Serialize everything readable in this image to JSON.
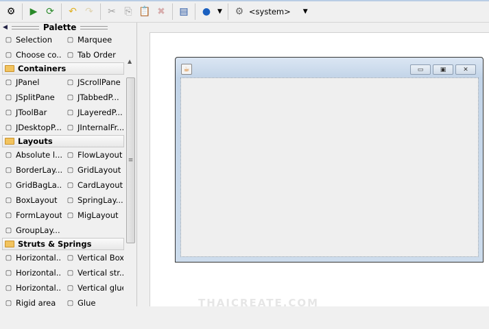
{
  "toolbar": {
    "items": [
      {
        "icon": "inspector-icon"
      },
      {
        "icon": "preview-design-icon"
      },
      {
        "icon": "refresh-icon"
      },
      {
        "icon": "undo-icon"
      },
      {
        "icon": "redo-icon"
      },
      {
        "icon": "cut-icon"
      },
      {
        "icon": "copy-icon"
      },
      {
        "icon": "paste-icon"
      },
      {
        "icon": "delete-icon"
      },
      {
        "icon": "test-form-icon"
      },
      {
        "icon": "globe-icon"
      }
    ],
    "lookfeel": "<system>"
  },
  "palette": {
    "title": "Palette",
    "top": [
      [
        "Selection",
        "Marquee"
      ],
      [
        "Choose co...",
        "Tab Order"
      ]
    ],
    "categories": [
      {
        "name": "Containers",
        "items": [
          [
            "JPanel",
            "JScrollPane"
          ],
          [
            "JSplitPane",
            "JTabbedP..."
          ],
          [
            "JToolBar",
            "JLayeredP..."
          ],
          [
            "JDesktopP...",
            "JInternalFr..."
          ]
        ]
      },
      {
        "name": "Layouts",
        "items": [
          [
            "Absolute l...",
            "FlowLayout"
          ],
          [
            "BorderLay...",
            "GridLayout"
          ],
          [
            "GridBagLa...",
            "CardLayout"
          ],
          [
            "BoxLayout",
            "SpringLay..."
          ],
          [
            "FormLayout",
            "MigLayout"
          ],
          [
            "GroupLay...",
            ""
          ]
        ]
      },
      {
        "name": "Struts & Springs",
        "items": [
          [
            "Horizontal...",
            "Vertical Box"
          ],
          [
            "Horizontal...",
            "Vertical str..."
          ],
          [
            "Horizontal...",
            "Vertical glue"
          ],
          [
            "Rigid area",
            "Glue"
          ]
        ]
      }
    ]
  },
  "watermark": "THAICREATE.COM"
}
